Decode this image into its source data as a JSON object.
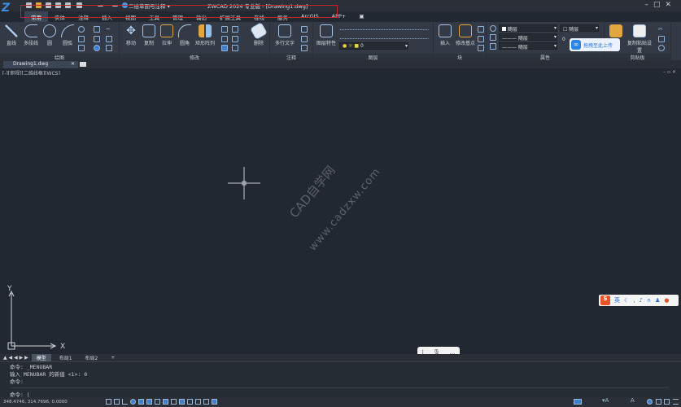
{
  "app": {
    "title": "ZWCAD 2024 专业版 - [Drawing1.dwg]",
    "workspace": "二维草图与注释"
  },
  "tabs": [
    "常用",
    "实体",
    "注释",
    "插入",
    "视图",
    "工具",
    "管理",
    "输出",
    "扩展工具",
    "在线",
    "服务",
    "ArcGIS",
    "APP+"
  ],
  "panels": {
    "draw": {
      "label": "绘图",
      "tools": [
        "直线",
        "多段线",
        "圆",
        "圆弧"
      ]
    },
    "modify": {
      "label": "修改",
      "tools": [
        "移动",
        "复制",
        "拉伸",
        "圆角",
        "矩形阵列",
        "删除"
      ]
    },
    "annotate": {
      "label": "注释",
      "tools": [
        "多行文字"
      ]
    },
    "layers": {
      "label": "图层",
      "tools": [
        "图层特性"
      ],
      "current_layer": "0"
    },
    "block": {
      "label": "块",
      "tools": [
        "插入",
        "修改基点"
      ]
    },
    "properties": {
      "label": "属性",
      "color": "随层",
      "linetype": "随层",
      "lineweight": "随层",
      "layer_combo": "随层",
      "value": "0"
    },
    "clipboard": {
      "label": "剪贴板",
      "tools": [
        "复制粘贴设置"
      ]
    }
  },
  "upload_popup": "拖拽至此上传",
  "doc_tab": "Drawing1.dwg",
  "viewport_label": "[-][俯视][二维线框][WCS]",
  "watermark": {
    "line1": "CAD自学网",
    "line2": "www.cadzxw.com"
  },
  "ucs": {
    "x": "X",
    "y": "Y"
  },
  "layout_tabs": [
    "模型",
    "布局1",
    "布局2",
    "+"
  ],
  "command": {
    "history": [
      "命令: _MENUBAR",
      "输入 MENUBAR 的新值 <1>: 0",
      "命令:"
    ],
    "prompt": "命令:"
  },
  "status": {
    "coords": "348.4746, 314.7696, 0.0000"
  },
  "ime": {
    "mode": "英"
  },
  "colors": {
    "canvas": "#222831",
    "ribbon": "#333a45",
    "accent": "#c0272d"
  }
}
